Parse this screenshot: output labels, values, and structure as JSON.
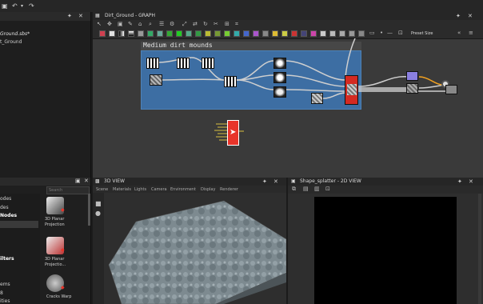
{
  "window": {
    "title": "Dirt_Ground - GRAPH"
  },
  "explorer": {
    "items": [
      "Ground.sbs*",
      "t_Ground"
    ]
  },
  "graph": {
    "frame_title": "Medium dirt mounds",
    "preset_label": "Preset Size"
  },
  "view3d": {
    "title": "3D VIEW",
    "menu": [
      "Scene",
      "Materials",
      "Lights",
      "Camera",
      "Environment",
      "Display",
      "Renderer"
    ]
  },
  "view2d": {
    "title": "Shape_splatter - 2D VIEW"
  },
  "library": {
    "search_placeholder": "Search",
    "categories": [
      "odes",
      "des",
      "Nodes",
      "",
      "",
      "",
      "ilters",
      "",
      "",
      "ems",
      "8",
      "ities"
    ],
    "items": [
      {
        "label": "3D Planar Projection"
      },
      {
        "label": "3D Planar Projectio..."
      },
      {
        "label": "Cracks Warp"
      }
    ]
  },
  "colors": {
    "accent": "#e8342a",
    "frame": "#3d6ea3",
    "orange_wire": "#f0a020"
  }
}
